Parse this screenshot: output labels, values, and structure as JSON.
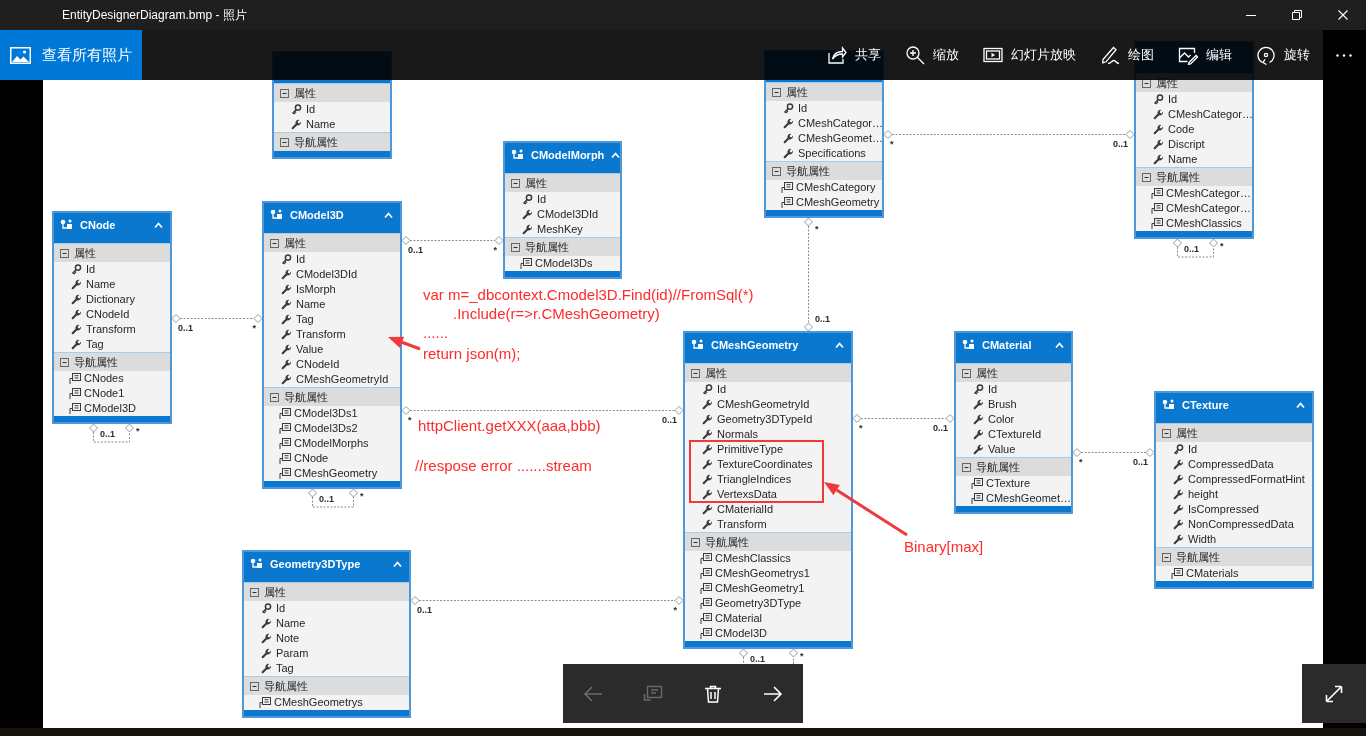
{
  "window": {
    "title": "EntityDesignerDiagram.bmp - 照片"
  },
  "app_bar": {
    "home_button": "查看所有照片",
    "actions": [
      {
        "kind": "share",
        "label": "共享"
      },
      {
        "kind": "zoom",
        "label": "缩放"
      },
      {
        "kind": "slideshow",
        "label": "幻灯片放映"
      },
      {
        "kind": "draw",
        "label": "绘图"
      },
      {
        "kind": "edit",
        "label": "编辑"
      },
      {
        "kind": "rotate",
        "label": "旋转"
      }
    ]
  },
  "diagram": {
    "entities": [
      {
        "properties_label": "属性",
        "properties": [
          {
            "name": "Id",
            "kind": "key"
          },
          {
            "name": "Name",
            "kind": "scalar"
          }
        ],
        "navigation_label": "导航属性"
      },
      {
        "properties_label": "属性",
        "properties": [
          {
            "name": "Id",
            "kind": "key"
          },
          {
            "name": "CMeshCategor…",
            "kind": "scalar"
          },
          {
            "name": "CMeshGeomet…",
            "kind": "scalar"
          },
          {
            "name": "Specifications",
            "kind": "scalar"
          }
        ],
        "navigation_label": "导航属性",
        "navigation": [
          "CMeshCategory",
          "CMeshGeometry"
        ]
      },
      {
        "properties_label": "属性",
        "properties": [
          {
            "name": "Id",
            "kind": "key"
          },
          {
            "name": "CMeshCategor…",
            "kind": "scalar"
          },
          {
            "name": "Code",
            "kind": "scalar"
          },
          {
            "name": "Discript",
            "kind": "scalar"
          },
          {
            "name": "Name",
            "kind": "scalar"
          }
        ],
        "navigation_label": "导航属性",
        "navigation": [
          "CMeshCategor…",
          "CMeshCategor…",
          "CMeshClassics"
        ]
      },
      {
        "title": "CModelMorph",
        "properties_label": "属性",
        "properties": [
          {
            "name": "Id",
            "kind": "key"
          },
          {
            "name": "CModel3DId",
            "kind": "scalar"
          },
          {
            "name": "MeshKey",
            "kind": "scalar"
          }
        ],
        "navigation_label": "导航属性",
        "navigation": [
          "CModel3Ds"
        ]
      },
      {
        "title": "CNode",
        "properties_label": "属性",
        "properties": [
          {
            "name": "Id",
            "kind": "key"
          },
          {
            "name": "Name",
            "kind": "scalar"
          },
          {
            "name": "Dictionary",
            "kind": "scalar"
          },
          {
            "name": "CNodeId",
            "kind": "scalar"
          },
          {
            "name": "Transform",
            "kind": "scalar"
          },
          {
            "name": "Tag",
            "kind": "scalar"
          }
        ],
        "navigation_label": "导航属性",
        "navigation": [
          "CNodes",
          "CNode1",
          "CModel3D"
        ]
      },
      {
        "title": "CModel3D",
        "properties_label": "属性",
        "properties": [
          {
            "name": "Id",
            "kind": "key"
          },
          {
            "name": "CModel3DId",
            "kind": "scalar"
          },
          {
            "name": "IsMorph",
            "kind": "scalar"
          },
          {
            "name": "Name",
            "kind": "scalar"
          },
          {
            "name": "Tag",
            "kind": "scalar"
          },
          {
            "name": "Transform",
            "kind": "scalar"
          },
          {
            "name": "Value",
            "kind": "scalar"
          },
          {
            "name": "CNodeId",
            "kind": "scalar"
          },
          {
            "name": "CMeshGeometryId",
            "kind": "scalar"
          }
        ],
        "navigation_label": "导航属性",
        "navigation": [
          "CModel3Ds1",
          "CModel3Ds2",
          "CModelMorphs",
          "CNode",
          "CMeshGeometry"
        ]
      },
      {
        "title": "CMeshGeometry",
        "properties_label": "属性",
        "properties": [
          {
            "name": "Id",
            "kind": "key"
          },
          {
            "name": "CMeshGeometryId",
            "kind": "scalar"
          },
          {
            "name": "Geometry3DTypeId",
            "kind": "scalar"
          },
          {
            "name": "Normals",
            "kind": "scalar"
          },
          {
            "name": "PrimitiveType",
            "kind": "scalar"
          },
          {
            "name": "TextureCoordinates",
            "kind": "scalar"
          },
          {
            "name": "TriangleIndices",
            "kind": "scalar"
          },
          {
            "name": "VertexsData",
            "kind": "scalar"
          },
          {
            "name": "CMaterialId",
            "kind": "scalar"
          },
          {
            "name": "Transform",
            "kind": "scalar"
          }
        ],
        "navigation_label": "导航属性",
        "navigation": [
          "CMeshClassics",
          "CMeshGeometrys1",
          "CMeshGeometry1",
          "Geometry3DType",
          "CMaterial",
          "CModel3D"
        ]
      },
      {
        "title": "CMaterial",
        "properties_label": "属性",
        "properties": [
          {
            "name": "Id",
            "kind": "key"
          },
          {
            "name": "Brush",
            "kind": "scalar"
          },
          {
            "name": "Color",
            "kind": "scalar"
          },
          {
            "name": "CTextureId",
            "kind": "scalar"
          },
          {
            "name": "Value",
            "kind": "scalar"
          }
        ],
        "navigation_label": "导航属性",
        "navigation": [
          "CTexture",
          "CMeshGeomet…"
        ]
      },
      {
        "title": "CTexture",
        "properties_label": "属性",
        "properties": [
          {
            "name": "Id",
            "kind": "key"
          },
          {
            "name": "CompressedData",
            "kind": "scalar"
          },
          {
            "name": "CompressedFormatHint",
            "kind": "scalar"
          },
          {
            "name": "height",
            "kind": "scalar"
          },
          {
            "name": "IsCompressed",
            "kind": "scalar"
          },
          {
            "name": "NonCompressedData",
            "kind": "scalar"
          },
          {
            "name": "Width",
            "kind": "scalar"
          }
        ],
        "navigation_label": "导航属性",
        "navigation": [
          "CMaterials"
        ]
      },
      {
        "title": "Geometry3DType",
        "properties_label": "属性",
        "properties": [
          {
            "name": "Id",
            "kind": "key"
          },
          {
            "name": "Name",
            "kind": "scalar"
          },
          {
            "name": "Note",
            "kind": "scalar"
          },
          {
            "name": "Param",
            "kind": "scalar"
          },
          {
            "name": "Tag",
            "kind": "scalar"
          }
        ],
        "navigation_label": "导航属性",
        "navigation": [
          "CMeshGeometrys"
        ]
      }
    ],
    "associations": [
      {
        "kind": "link",
        "end_1": "0..1",
        "end_2": "*"
      },
      {
        "kind": "link",
        "end_1": "0..1",
        "end_2": "*"
      },
      {
        "kind": "link",
        "end_1": "*",
        "end_2": "0..1"
      },
      {
        "kind": "link",
        "end_1": "*",
        "end_2": "0..1"
      },
      {
        "kind": "link",
        "end_1": "*",
        "end_2": "0..1"
      },
      {
        "kind": "link",
        "end_1": "*",
        "end_2": "0..1"
      },
      {
        "kind": "link",
        "end_1": "*",
        "end_2": "0..1"
      },
      {
        "kind": "link",
        "end_1": "0..1",
        "end_2": "*"
      },
      {
        "kind": "self",
        "end_1": "0..1",
        "end_2": "*"
      },
      {
        "kind": "self",
        "end_1": "0..1",
        "end_2": "*"
      },
      {
        "kind": "self",
        "end_1": "0..1",
        "end_2": "*"
      },
      {
        "kind": "self",
        "end_1": "0..1",
        "end_2": "*"
      }
    ],
    "annotations": [
      {
        "text": "var m=_dbcontext.Cmodel3D.Find(id)//FromSql(*)"
      },
      {
        "text": ".Include(r=>r.CMeshGeometry)"
      },
      {
        "text": "......"
      },
      {
        "text": "return json(m);"
      },
      {
        "text": "httpClient.getXXX(aaa,bbb)"
      },
      {
        "text": "//respose error .......stream"
      },
      {
        "text": "Binary[max]"
      }
    ]
  },
  "media_controls": [
    {
      "kind": "previous",
      "disabled": true
    },
    {
      "kind": "present",
      "disabled": true
    },
    {
      "kind": "delete",
      "disabled": false
    },
    {
      "kind": "next",
      "disabled": false
    }
  ]
}
